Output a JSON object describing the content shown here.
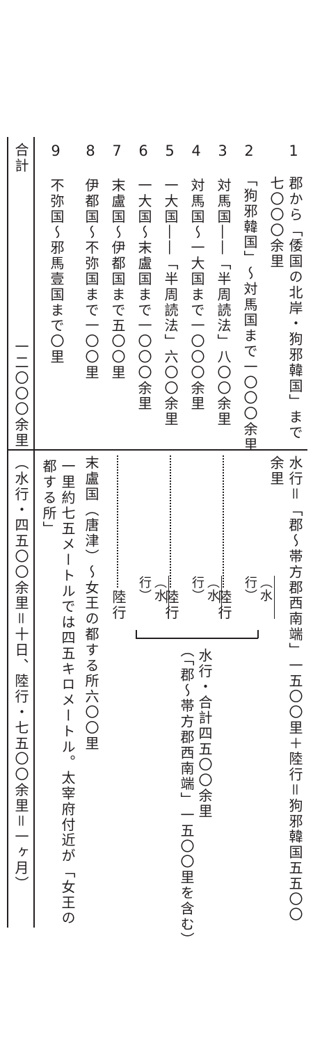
{
  "top": {
    "rows": [
      {
        "no": "1",
        "text": "郡から「倭国の北岸・狗邪韓国」まで七〇〇〇余里"
      },
      {
        "no": "2",
        "text": "「狗邪韓国」～対馬国まで一〇〇〇余里"
      },
      {
        "no": "3",
        "text": "対馬国――「半周読法」八〇〇余里"
      },
      {
        "no": "4",
        "text": "対馬国～一大国まで一〇〇〇余里"
      },
      {
        "no": "5",
        "text": "一大国――「半周読法」六〇〇余里"
      },
      {
        "no": "6",
        "text": "一大国～末盧国まで一〇〇〇余里"
      },
      {
        "no": "7",
        "text": "末盧国～伊都国まで五〇〇里"
      },
      {
        "no": "8",
        "text": "伊都国～不弥国まで一〇〇里"
      },
      {
        "no": "9",
        "text": "不弥国～邪馬壹国まで〇里"
      }
    ],
    "total_label": "合計",
    "total_value": "一二〇〇〇余里"
  },
  "bottom": {
    "summary": "水行＝「郡～帯方郡西南端」一五〇〇里＋陸行＝狗邪韓国五五〇〇余里",
    "legs": [
      "（水行）",
      "陸行",
      "（水行）",
      "陸行",
      "（水行）",
      "陸行"
    ],
    "water_total": "水行・合計四五〇〇余里",
    "water_note": "（「郡～帯方郡西南端」一五〇〇里を含む）",
    "matsura": "末盧国（唐津）～女王の都する所六〇〇里",
    "note": "一里約七五メートルでは四五キロメートル。太宰府付近が「女王の都する所」",
    "total": "（水行・四五〇〇余里＝十日、陸行・七五〇〇余里＝一ヶ月）"
  }
}
